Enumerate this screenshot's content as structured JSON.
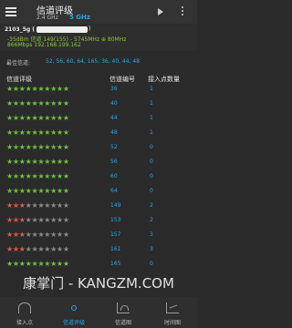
{
  "appbar": {
    "title": "信道评级",
    "bands": [
      "2.4 GHz",
      "5 GHz"
    ],
    "active_band": "5 GHz",
    "icons": [
      "menu-icon",
      "play-icon",
      "more-icon"
    ]
  },
  "connection": {
    "ssid": "2103_5g (",
    "ssid_tail": ")",
    "line2": "-35dBm  信道 149(155) - 5745MHz  ⊕ 80MHz",
    "line3": "866Mbps  192.168.199.162"
  },
  "best": {
    "label": "最佳信道:",
    "values": "52, 56, 60, 64, 165, 36, 40, 44, 48"
  },
  "table": {
    "headers": {
      "rating": "信道评级",
      "channel": "信道编号",
      "count": "接入点数量"
    },
    "rows": [
      {
        "rating": 10,
        "channel": "36",
        "count": "1"
      },
      {
        "rating": 10,
        "channel": "40",
        "count": "1"
      },
      {
        "rating": 10,
        "channel": "44",
        "count": "1"
      },
      {
        "rating": 10,
        "channel": "48",
        "count": "1"
      },
      {
        "rating": 10,
        "channel": "52",
        "count": "0"
      },
      {
        "rating": 10,
        "channel": "56",
        "count": "0"
      },
      {
        "rating": 10,
        "channel": "60",
        "count": "0"
      },
      {
        "rating": 10,
        "channel": "64",
        "count": "0"
      },
      {
        "rating": 3,
        "channel": "149",
        "count": "2"
      },
      {
        "rating": 3,
        "channel": "153",
        "count": "2"
      },
      {
        "rating": 3,
        "channel": "157",
        "count": "3"
      },
      {
        "rating": 3,
        "channel": "161",
        "count": "3"
      },
      {
        "rating": 10,
        "channel": "165",
        "count": "0"
      }
    ]
  },
  "nav": {
    "items": [
      {
        "label": "接入点",
        "icon": "access-point-icon"
      },
      {
        "label": "信道评级",
        "icon": "channel-rating-icon"
      },
      {
        "label": "信道图",
        "icon": "channel-graph-icon"
      },
      {
        "label": "时间图",
        "icon": "time-graph-icon"
      }
    ],
    "active": "信道评级"
  },
  "watermark": "康掌门 - KANGZM.COM",
  "colors": {
    "accent": "#29a5e6",
    "good": "#6fbf3f",
    "bad": "#e0584d"
  }
}
